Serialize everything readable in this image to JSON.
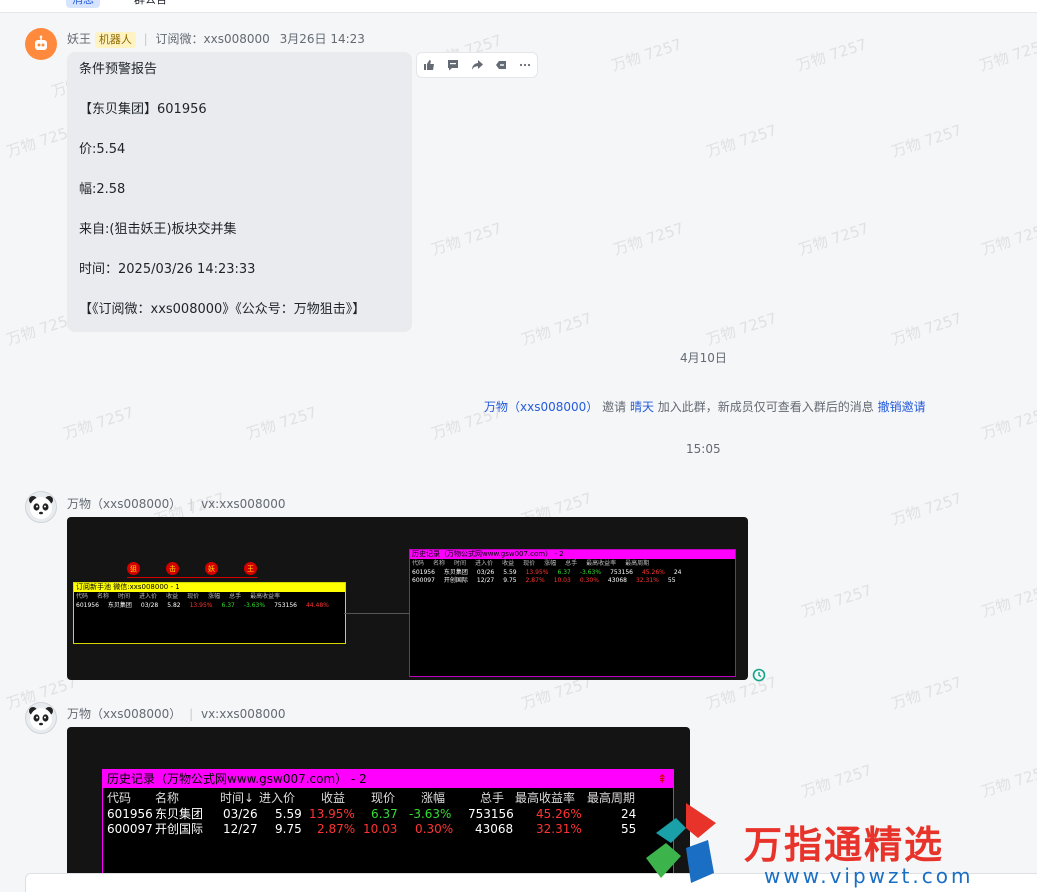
{
  "top_tabs": [
    "消息",
    "群公告"
  ],
  "watermark_text": "万物 7257",
  "msg1": {
    "sender": "妖王",
    "badge": "机器人",
    "subtitle": "订阅微：xxs008000",
    "time": "3月26日 14:23",
    "lines": [
      "条件预警报告",
      "【东贝集团】601956",
      "价:5.54",
      "幅:2.58",
      "来自:(狙击妖王)板块交并集",
      "时间：2025/03/26 14:23:33",
      "【《订阅微：xxs008000》《公众号：万物狙击》】"
    ]
  },
  "date_divider": "4月10日",
  "system": {
    "inviter": "万物（xxs008000）",
    "verb": "邀请",
    "invitee": "晴天",
    "rest": "加入此群，新成员仅可查看入群后的消息",
    "action": "撤销邀请"
  },
  "time_divider": "15:05",
  "msg2": {
    "sender": "万物（xxs008000）",
    "subtitle": "vx:xxs008000",
    "balls": [
      "狙",
      "击",
      "妖",
      "王"
    ],
    "yellow_title": "订阅新手池   微信:xxs008000 - 1",
    "yellow_headers": [
      "代码",
      "名称",
      "时间",
      "进入价",
      "收益",
      "现价",
      "涨幅",
      "总手",
      "最高收益率"
    ],
    "yellow_row": [
      "601956",
      "东贝集团",
      "03/28",
      "5.82",
      "13.95%",
      "6.37",
      "-3.63%",
      "753156",
      "44.48%"
    ],
    "magenta_title": "历史记录（万物公式网www.gsw007.com） - 2",
    "magenta_headers": [
      "代码",
      "名称",
      "时间",
      "进入价",
      "收益",
      "现价",
      "涨幅",
      "总手",
      "最高收益率",
      "最高周期"
    ],
    "magenta_rows": [
      [
        "601956",
        "东贝集团",
        "03/26",
        "5.59",
        "13.95%",
        "6.37",
        "-3.63%",
        "753156",
        "45.26%",
        "24"
      ],
      [
        "600097",
        "开创国际",
        "12/27",
        "9.75",
        "2.87%",
        "10.03",
        "0.30%",
        "43068",
        "32.31%",
        "55"
      ]
    ]
  },
  "msg3": {
    "sender": "万物（xxs008000）",
    "subtitle": "vx:xxs008000",
    "title": "历史记录（万物公式网www.gsw007.com） - 2",
    "headers": [
      "代码",
      "名称",
      "时间↓",
      "进入价",
      "收益",
      "现价",
      "涨幅",
      "总手",
      "最高收益率",
      "最高周期"
    ],
    "rows": [
      [
        "601956",
        "东贝集团",
        "03/26",
        "5.59",
        "13.95%",
        "6.37",
        "-3.63%",
        "753156",
        "45.26%",
        "24"
      ],
      [
        "600097",
        "开创国际",
        "12/27",
        "9.75",
        "2.87%",
        "10.03",
        "0.30%",
        "43068",
        "32.31%",
        "55"
      ]
    ]
  },
  "brand": {
    "name": "万指通精选",
    "url": "www.vipwzt.com"
  },
  "colors": {
    "accent": "#245bdb",
    "gain": "#ff3333",
    "loss": "#33dd33",
    "magenta": "#ff00ff",
    "yellow": "#ffff00"
  }
}
